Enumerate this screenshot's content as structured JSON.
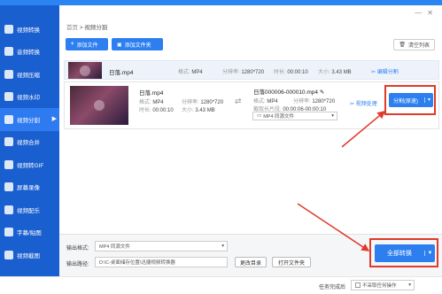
{
  "colors": {
    "accent": "#2d7ff0",
    "sidebar": "#1a5fd0",
    "highlight": "#e03a2a"
  },
  "sidebar": {
    "items": [
      {
        "label": "视频转换",
        "icon": "video-convert-icon"
      },
      {
        "label": "音频转换",
        "icon": "audio-convert-icon"
      },
      {
        "label": "视频压缩",
        "icon": "video-compress-icon"
      },
      {
        "label": "视频水印",
        "icon": "watermark-icon"
      },
      {
        "label": "视频分割",
        "icon": "video-split-icon",
        "active": true
      },
      {
        "label": "视频合并",
        "icon": "video-merge-icon"
      },
      {
        "label": "视频转GIF",
        "icon": "gif-icon"
      },
      {
        "label": "屏幕录像",
        "icon": "screen-record-icon"
      },
      {
        "label": "视频配乐",
        "icon": "music-icon"
      },
      {
        "label": "字幕/贴图",
        "icon": "subtitle-icon"
      },
      {
        "label": "视频截图",
        "icon": "screenshot-icon"
      }
    ]
  },
  "breadcrumb": {
    "home": "首页",
    "sep": ">",
    "current": "视频分割"
  },
  "toolbar": {
    "add_file": "添加文件",
    "add_folder": "添加文件夹",
    "clear_list": "清空列表"
  },
  "file1": {
    "name": "日落.mp4",
    "format_label": "格式:",
    "format": "MP4",
    "res_label": "分辨率:",
    "res": "1280*720",
    "duration_label": "时长:",
    "duration": "00:00:10",
    "size_label": "大小:",
    "size": "3.43 MB",
    "edit_split": "编辑分割"
  },
  "file2": {
    "name": "日落.mp4",
    "format_label": "格式:",
    "format": "MP4",
    "res_label": "分辨率:",
    "res": "1280*720",
    "duration_label": "时长:",
    "duration": "00:00:10",
    "size_label": "大小:",
    "size": "3.43 MB",
    "out_name": "日落000006-000010.mp4",
    "out_format": "MP4",
    "out_res": "1280*720",
    "clip_label": "截取长片段:",
    "clip": "00:00:06-00:00:10",
    "out_select": "MP4 同源文件",
    "video_process": "视频处理",
    "split_btn": "分割(原速)"
  },
  "output": {
    "format_label": "输出格式:",
    "format_value": "MP4 同源文件",
    "path_label": "输出路径:",
    "path_value": "D:\\C-桌面储存位置\\迅捷视频转换器",
    "change_dir": "更改目录",
    "open_folder": "打开文件夹",
    "convert_all": "全部转换"
  },
  "status": {
    "task_done": "任务完成后",
    "option": "不采取任何操作"
  }
}
